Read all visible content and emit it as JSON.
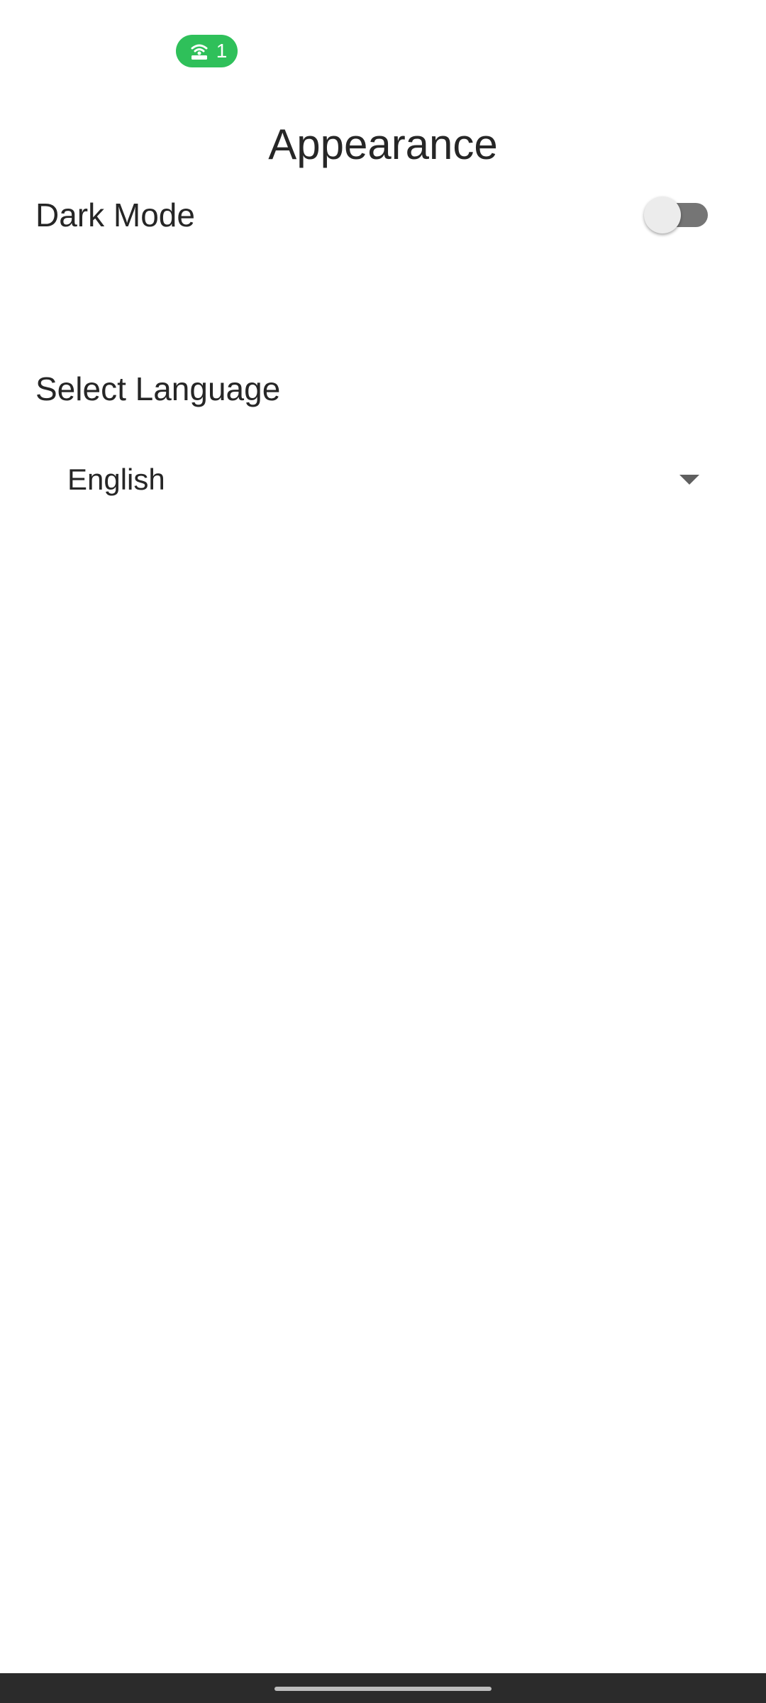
{
  "status_bar": {
    "hotspot_count": "1",
    "hotspot_icon": "hotspot-icon",
    "pill_color": "#2fc05a"
  },
  "header": {
    "title": "Appearance"
  },
  "settings": {
    "dark_mode_label": "Dark Mode",
    "dark_mode_enabled": false,
    "switch_track_color": "#757575",
    "switch_thumb_color": "#ececec"
  },
  "language": {
    "section_title": "Select Language",
    "selected": "English",
    "dropdown_icon": "dropdown-arrow-icon"
  },
  "navigation_bar": {
    "background": "#2b2b2b",
    "handle_color": "#bdbdbd"
  }
}
